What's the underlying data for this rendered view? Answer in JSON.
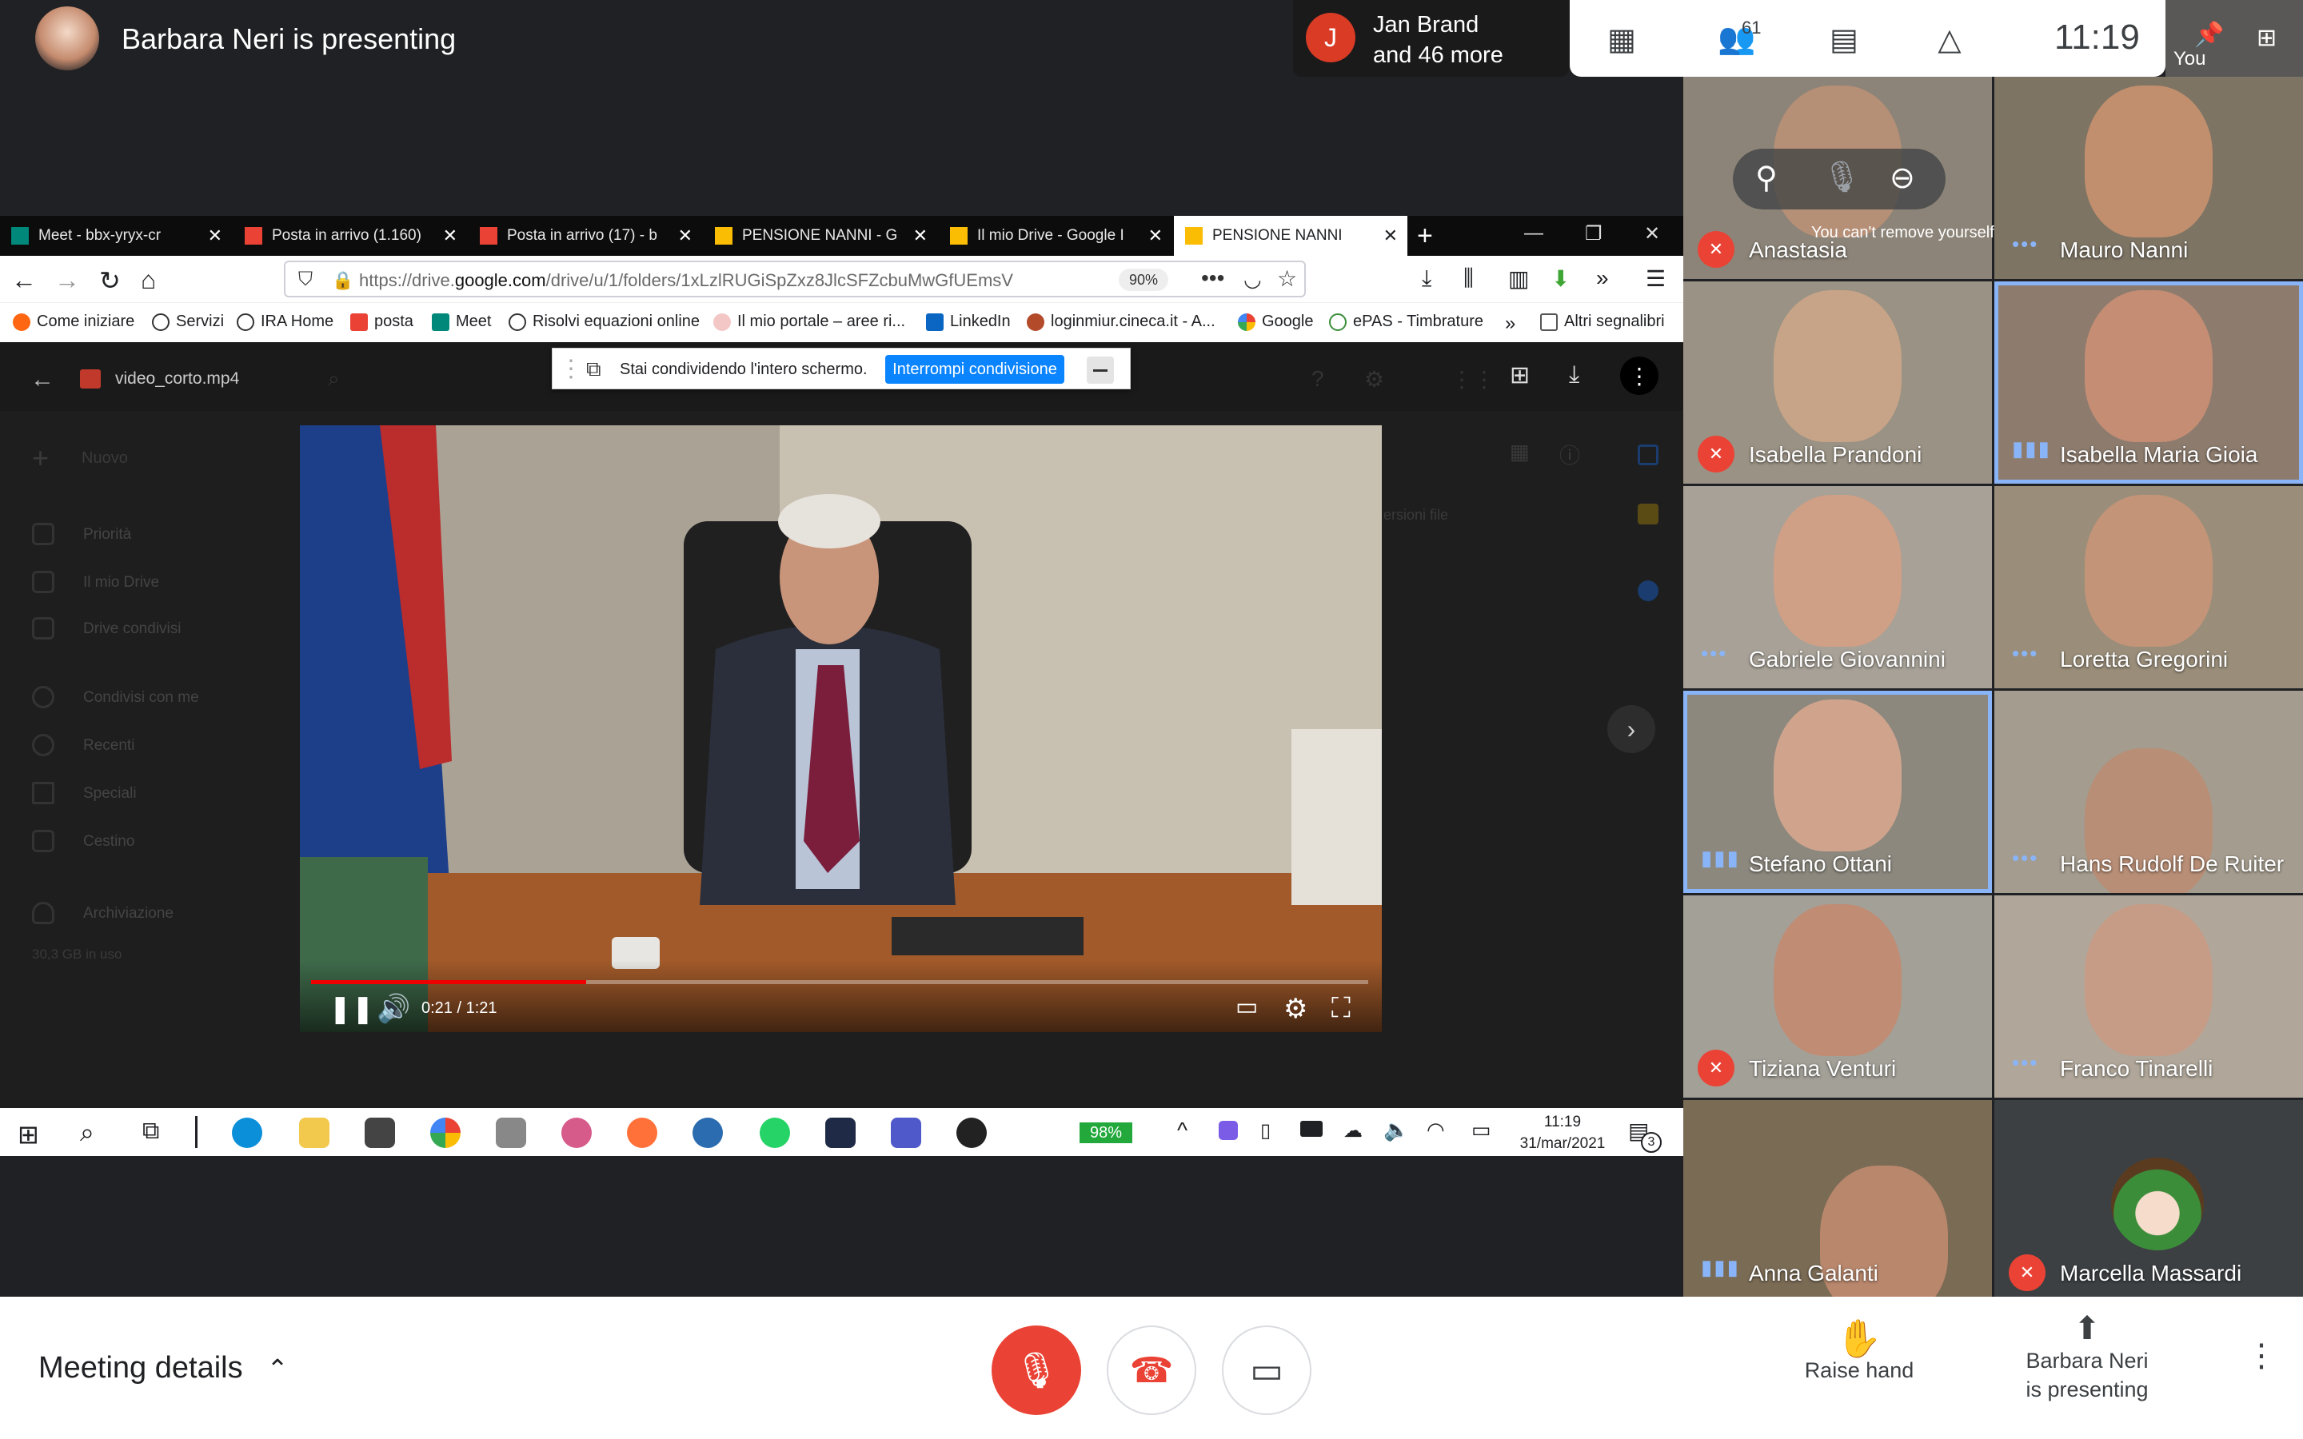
{
  "meet": {
    "presenting_title": "Barbara Neri is presenting",
    "notification": {
      "avatar_letter": "J",
      "line1": "Jan Brand",
      "line2": "and 46 more"
    },
    "participants_count": "61",
    "clock": "11:19",
    "self_label": "You",
    "hover_tooltip": "You can't remove yourself"
  },
  "browser": {
    "tabs": [
      {
        "label": "Meet - bbx-yryx-cr",
        "icon_color": "#00897b"
      },
      {
        "label": "Posta in arrivo (1.160)",
        "icon_color": "#ea4335"
      },
      {
        "label": "Posta in arrivo (17) - b",
        "icon_color": "#ea4335"
      },
      {
        "label": "PENSIONE NANNI - G",
        "icon_color": "#fbbc04"
      },
      {
        "label": "Il mio Drive - Google I",
        "icon_color": "#fbbc04"
      },
      {
        "label": "PENSIONE NANNI",
        "icon_color": "#fbbc04"
      }
    ],
    "url_prefix": "https://drive.",
    "url_domain": "google.com",
    "url_path": "/drive/u/1/folders/1xLzlRUGiSpZxz8JlcSFZcbuMwGfUEmsV",
    "zoom": "90%",
    "bookmarks": [
      "Come iniziare",
      "Servizi",
      "IRA Home",
      "posta",
      "Meet",
      "Risolvi equazioni online",
      "Il mio portale – aree ri...",
      "LinkedIn",
      "loginmiur.cineca.it - A...",
      "Google",
      "ePAS - Timbrature",
      "Altri segnalibri"
    ]
  },
  "drive": {
    "file_name": "video_corto.mp4",
    "new_label": "Nuovo",
    "sidebar": [
      "Priorità",
      "Il mio Drive",
      "Drive condivisi",
      "Condivisi con me",
      "Recenti",
      "Speciali",
      "Cestino",
      "Archiviazione",
      "30,3 GB in uso"
    ],
    "side_text": "ersioni file",
    "share_text": "Stai condividendo l'intero schermo.",
    "share_stop": "Interrompi condivisione",
    "video_time": "0:21 / 1:21",
    "video_progress": 0.26
  },
  "taskbar": {
    "battery": "98%",
    "time": "11:19",
    "date": "31/mar/2021",
    "badge": "3"
  },
  "participants": [
    {
      "name": "Anastasia",
      "state": "muted"
    },
    {
      "name": "Mauro Nanni",
      "state": "talking"
    },
    {
      "name": "Isabella Prandoni",
      "state": "muted"
    },
    {
      "name": "Isabella Maria Gioia",
      "state": "talking"
    },
    {
      "name": "Gabriele Giovannini",
      "state": "talking"
    },
    {
      "name": "Loretta Gregorini",
      "state": "talking"
    },
    {
      "name": "Stefano Ottani",
      "state": "talking"
    },
    {
      "name": "Hans Rudolf De Ruiter",
      "state": "talking"
    },
    {
      "name": "Tiziana Venturi",
      "state": "muted"
    },
    {
      "name": "Franco Tinarelli",
      "state": "talking"
    },
    {
      "name": "Anna Galanti",
      "state": "talking"
    },
    {
      "name": "Marcella Massardi",
      "state": "muted"
    }
  ],
  "bottom": {
    "meeting_details": "Meeting details",
    "raise_hand": "Raise hand",
    "presenting_line1": "Barbara Neri",
    "presenting_line2": "is presenting"
  },
  "colors": {
    "accent_red": "#ea4335",
    "accent_blue": "#8ab4f8",
    "firefox_blue": "#0a84ff"
  }
}
